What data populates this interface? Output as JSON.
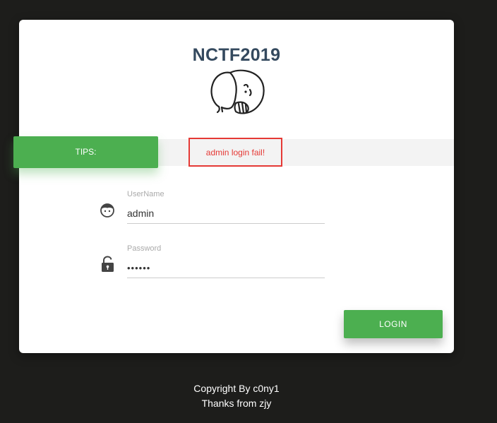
{
  "header": {
    "title": "NCTF2019",
    "logo_icon": "elephant-icon"
  },
  "tips": {
    "label": "TIPS:",
    "message": "admin login fail!"
  },
  "form": {
    "username": {
      "label": "UserName",
      "value": "admin",
      "icon": "user-face-icon"
    },
    "password": {
      "label": "Password",
      "value": "••••••",
      "icon": "unlock-icon"
    },
    "login_label": "LOGIN"
  },
  "footer": {
    "line1": "Copyright By c0ny1",
    "line2": "Thanks from zjy"
  },
  "colors": {
    "accent": "#4caf50",
    "error": "#e53935",
    "title": "#34495e",
    "background": "#1d1d1b"
  }
}
